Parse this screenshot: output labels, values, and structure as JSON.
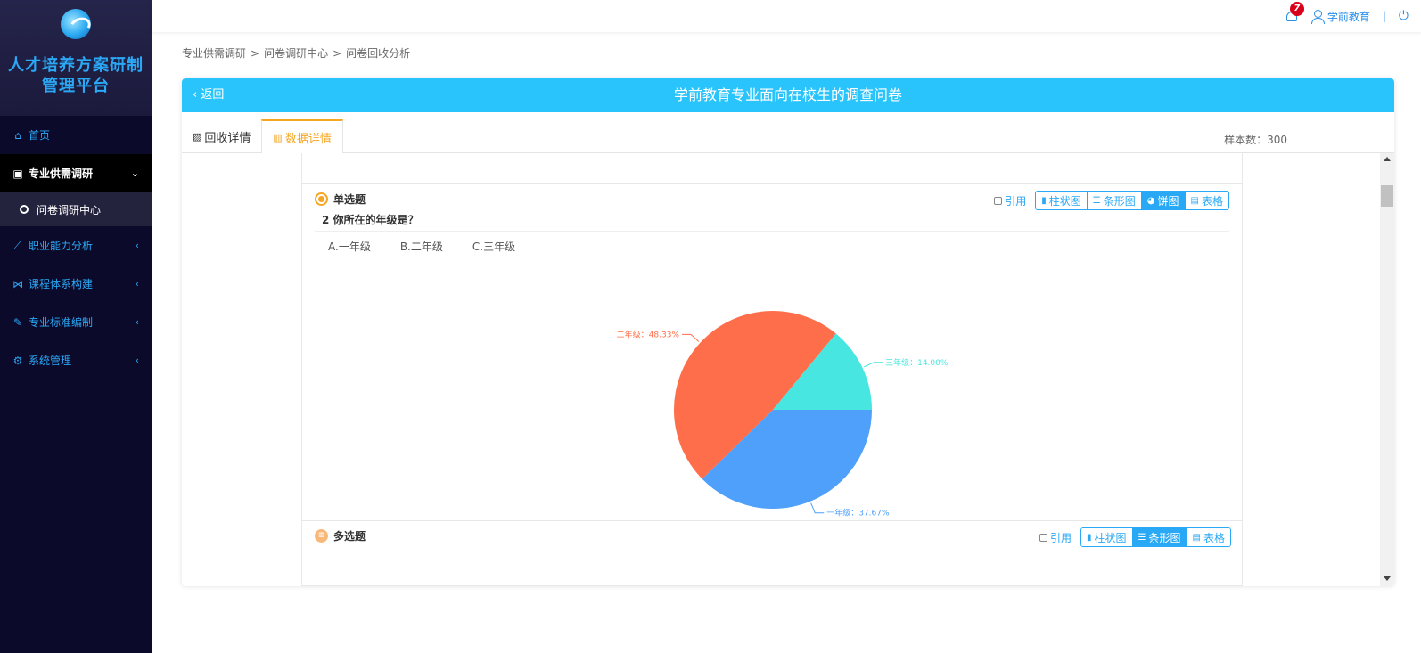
{
  "sidebar": {
    "app_title_line1": "人才培养方案研制",
    "app_title_line2": "管理平台",
    "items": [
      {
        "label": "首页"
      },
      {
        "label": "专业供需调研"
      },
      {
        "label": "问卷调研中心"
      },
      {
        "label": "职业能力分析"
      },
      {
        "label": "课程体系构建"
      },
      {
        "label": "专业标准编制"
      },
      {
        "label": "系统管理"
      }
    ]
  },
  "topbar": {
    "notification_count": "7",
    "username": "学前教育",
    "separator": "|"
  },
  "breadcrumb": {
    "items": [
      "专业供需调研",
      "问卷调研中心",
      "问卷回收分析"
    ],
    "separator": ">"
  },
  "card": {
    "back_label": "返回",
    "title": "学前教育专业面向在校生的调查问卷",
    "tabs": [
      {
        "label": "回收详情",
        "active": false
      },
      {
        "label": "数据详情",
        "active": true
      }
    ],
    "sample_label": "样本数：300"
  },
  "question1": {
    "type_label": "单选题",
    "text": "2 你所在的年级是？",
    "options": [
      "A.一年级",
      "B.二年级",
      "C.三年级"
    ],
    "cite_label": "引用",
    "view_buttons": [
      {
        "label": "柱状图",
        "selected": false
      },
      {
        "label": "条形图",
        "selected": false
      },
      {
        "label": "饼图",
        "selected": true
      },
      {
        "label": "表格",
        "selected": false
      }
    ]
  },
  "question2": {
    "type_label": "多选题",
    "cite_label": "引用",
    "view_buttons": [
      {
        "label": "柱状图",
        "selected": false
      },
      {
        "label": "条形图",
        "selected": true
      },
      {
        "label": "表格",
        "selected": false
      }
    ]
  },
  "chart_data": {
    "type": "pie",
    "slices": [
      {
        "label": "一年级",
        "value": 37.67,
        "display": "一年级：37.67%",
        "color": "#4fa0fb"
      },
      {
        "label": "二年级",
        "value": 48.33,
        "display": "二年级：48.33%",
        "color": "#ff6e4a"
      },
      {
        "label": "三年级",
        "value": 14.0,
        "display": "三年级：14.00%",
        "color": "#48e6e0"
      }
    ]
  },
  "colors": {
    "accent": "#29c4fb",
    "sidebar_bg": "#0c0a2b",
    "tab_active": "#f5a623"
  }
}
